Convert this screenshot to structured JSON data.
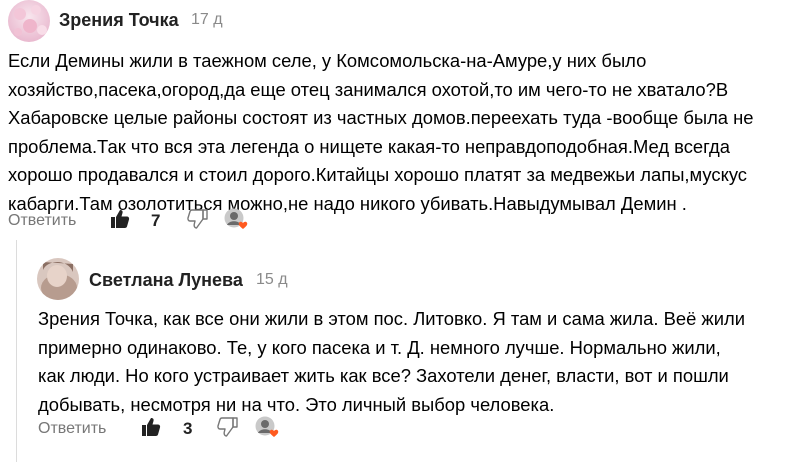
{
  "comment": {
    "author": "Зрения Точка",
    "time": "17 д",
    "lines": [
      "Если Демины жили в таежном селе, у Комсомольска-на-Амуре,у них было",
      "хозяйство,пасека,огород,да еще отец занимался охотой,то им чего-то не хватало?В",
      "Хабаровске целые районы состоят из частных домов.переехать туда -вообще была не",
      "проблема.Так что вся эта легенда о нищете какая-то неправдоподобная.Мед всегда",
      "хорошо продавался и стоил дорого.Китайцы хорошо платят за медвежьи лапы,мускус",
      "кабарги.Там озолотиться можно,не надо никого убивать.Навыдумывал Демин ."
    ],
    "reply_label": "Ответить",
    "likes": "7"
  },
  "reply": {
    "author": "Светлана Лунева",
    "time": "15 д",
    "lines": [
      "Зрения Точка, как все они жили в этом пос. Литовко. Я там и сама жила. Веё жили",
      "примерно одинаково. Те, у кого пасека и т. Д. немного лучше. Нормально жили,",
      "как люди. Но кого устраивает жить как все? Захотели денег, власти, вот и пошли",
      "добывать, несмотря ни на что. Это личный выбор человека."
    ],
    "reply_label": "Ответить",
    "likes": "3"
  },
  "icons": [
    "thumbs-up-icon",
    "thumbs-down-icon",
    "reactor-avatar-with-heart"
  ],
  "colors": {
    "text": "#000000",
    "muted": "#777777",
    "heart": "#ff5a1f",
    "thread_line": "#dcdcdc"
  }
}
